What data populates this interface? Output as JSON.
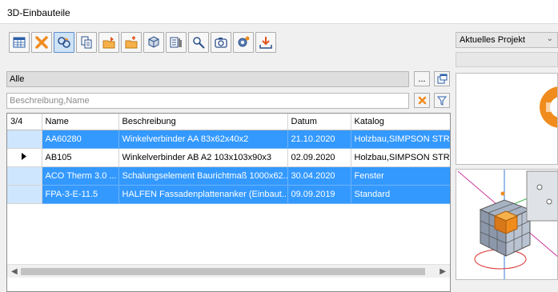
{
  "window": {
    "title": "3D-Einbauteile"
  },
  "toolbar": {
    "buttons": [
      {
        "icon": "table-grid-icon"
      },
      {
        "icon": "delete-x-icon"
      },
      {
        "icon": "linked-items-icon"
      },
      {
        "icon": "copy-icon"
      },
      {
        "icon": "export-folder-icon"
      },
      {
        "icon": "import-folder-icon"
      },
      {
        "icon": "3d-part-icon"
      },
      {
        "icon": "properties-icon"
      },
      {
        "icon": "view-settings-icon"
      },
      {
        "icon": "camera-icon"
      },
      {
        "icon": "gear-icon"
      },
      {
        "icon": "download-icon"
      }
    ]
  },
  "filter": {
    "value": "Alle",
    "more_label": "..."
  },
  "search": {
    "placeholder": "Beschreibung,Name"
  },
  "table": {
    "count": "3/4",
    "columns": [
      "Name",
      "Beschreibung",
      "Datum",
      "Katalog"
    ],
    "rows": [
      {
        "name": "AA60280",
        "beschreibung": "Winkelverbinder AA 83x62x40x2",
        "datum": "21.10.2020",
        "katalog": "Holzbau,SIMPSON STRONG",
        "selected": true,
        "current": false
      },
      {
        "name": "AB105",
        "beschreibung": "Winkelverbinder AB A2 103x103x90x3",
        "datum": "02.09.2020",
        "katalog": "Holzbau,SIMPSON STRONG",
        "selected": false,
        "current": true
      },
      {
        "name": "ACO Therm 3.0 ...",
        "beschreibung": "Schalungselement Baurichtmaß 1000x62...",
        "datum": "30.04.2020",
        "katalog": "Fenster",
        "selected": true,
        "current": false
      },
      {
        "name": "FPA-3-E-11.5",
        "beschreibung": "HALFEN Fassadenplattenanker (Einbaut...",
        "datum": "09.09.2019",
        "katalog": "Standard",
        "selected": true,
        "current": false
      }
    ]
  },
  "project": {
    "selected": "Aktuelles Projekt"
  },
  "colors": {
    "selection": "#3399ff",
    "accent": "#f08c1e"
  }
}
